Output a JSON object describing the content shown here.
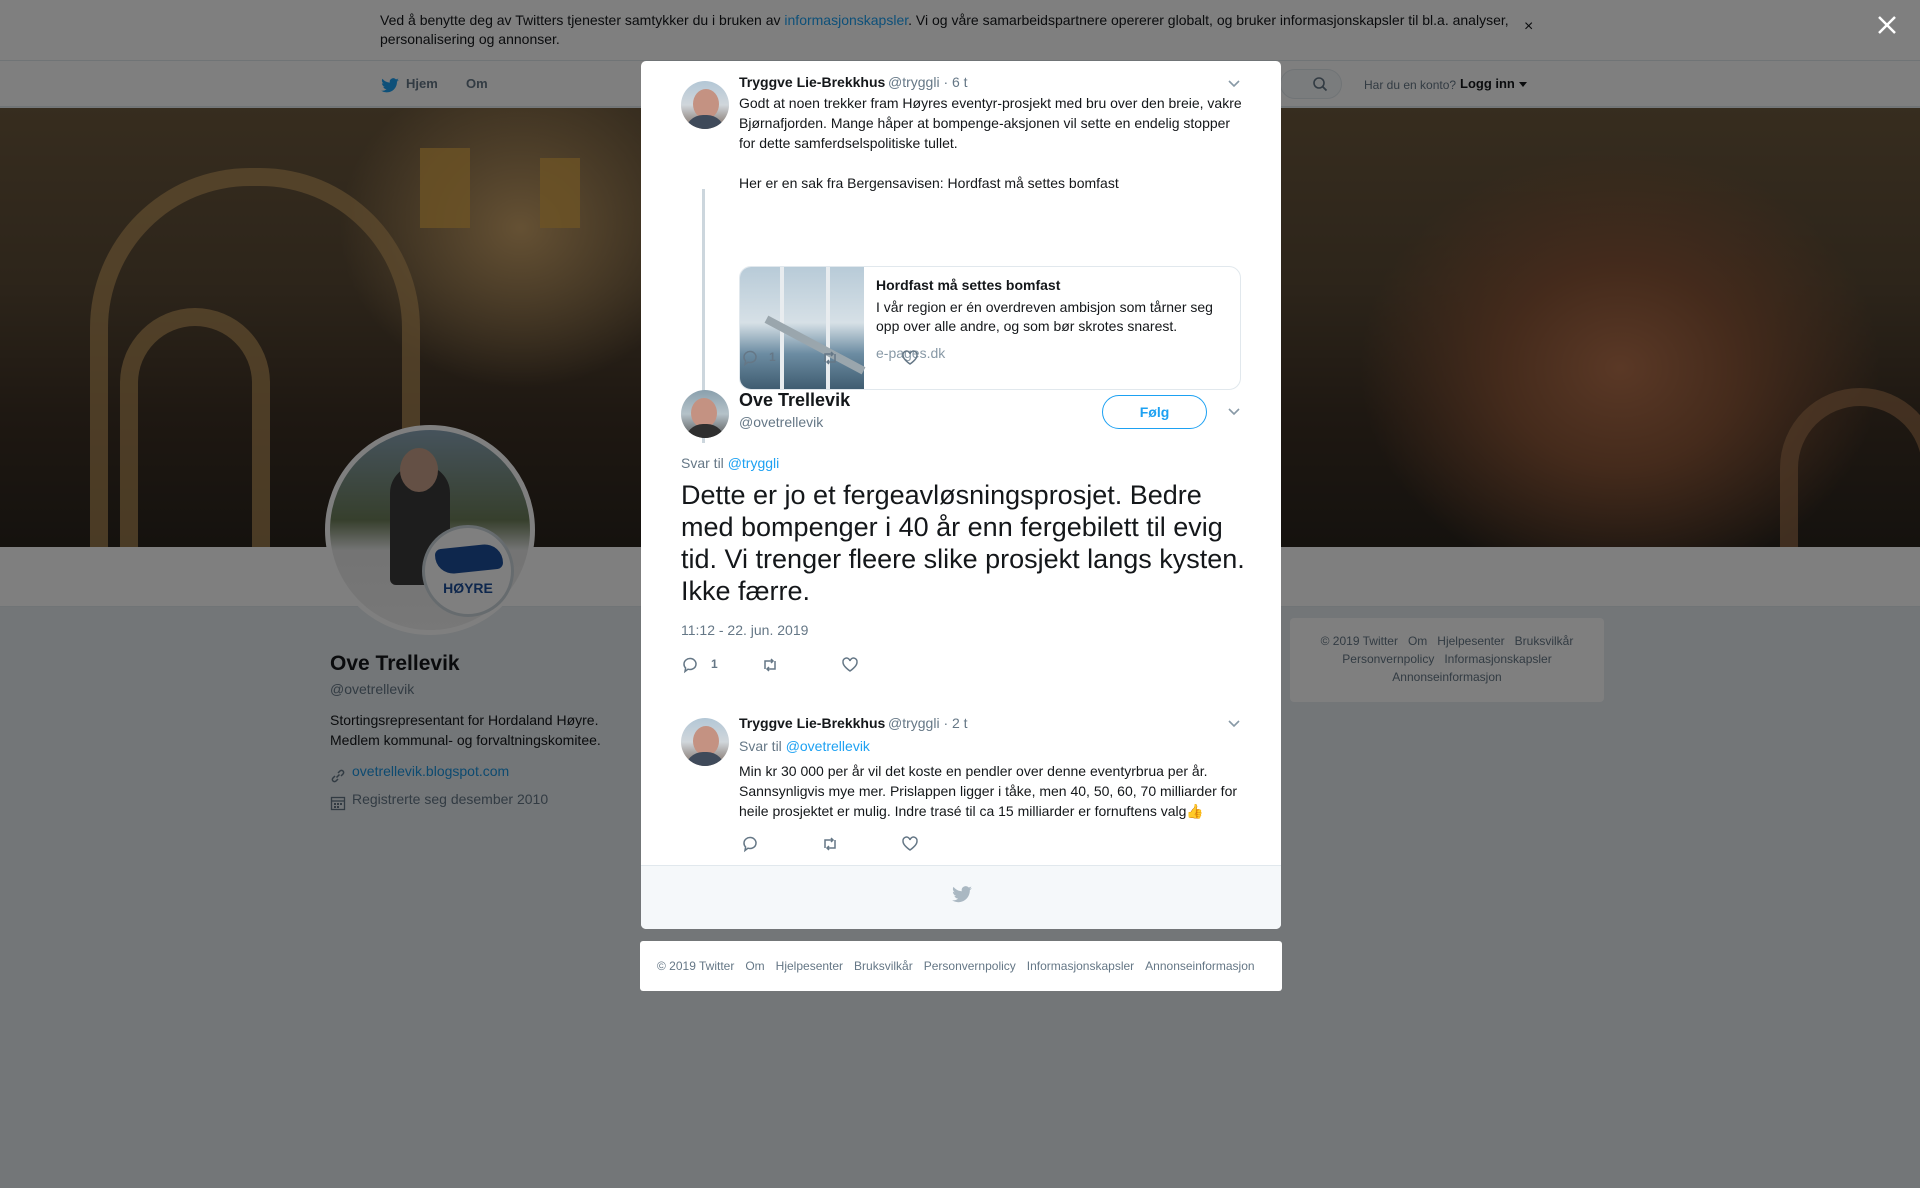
{
  "cookie": {
    "text_before": "Ved å benytte deg av Twitters tjenester samtykker du i bruken av ",
    "link": "informasjonskapsler",
    "text_after": ". Vi og våre samarbeidspartnere opererer globalt, og bruker informasjonskapsler til bl.a. analyser, personalisering og annonser.",
    "close": "×"
  },
  "nav": {
    "home": "Hjem",
    "about": "Om",
    "login_question": "Har du en konto?",
    "login": "Logg inn"
  },
  "avatar_badge": {
    "text": "HØYRE"
  },
  "profile": {
    "name": "Ove Trellevik",
    "handle": "@ovetrellevik",
    "bio": "Stortingsrepresentant for Hordaland Høyre. Medlem kommunal- og forvaltningskomitee.",
    "url": "ovetrellevik.blogspot.com",
    "joined": "Registrerte seg desember 2010"
  },
  "side_footer": [
    "© 2019 Twitter",
    "Om",
    "Hjelpesenter",
    "Bruksvilkår",
    "Personvernpolicy",
    "Informasjonskapsler",
    "Annonseinformasjon"
  ],
  "modal": {
    "parent_tweet": {
      "name": "Tryggve Lie-Brekkhus",
      "handle": "@tryggli",
      "time": "· 6 t",
      "text": "Godt at noen trekker fram Høyres eventyr-prosjekt med bru over den breie, vakre Bjørnafjorden. Mange håper at bompenge-aksjonen vil sette en endelig stopper for dette samferdselspolitiske tullet.",
      "text2": "Her er en sak fra Bergensavisen: Hordfast må settes bomfast",
      "card": {
        "title": "Hordfast må settes bomfast",
        "description": "I vår region er én overdreven ambisjon som tårner seg opp over alle andre, og som bør skrotes snarest.",
        "domain": "e-pages.dk"
      },
      "reply_count": "1"
    },
    "main_tweet": {
      "name": "Ove Trellevik",
      "handle": "@ovetrellevik",
      "follow": "Følg",
      "reply_label": "Svar til ",
      "reply_to": "@tryggli",
      "text": "Dette er jo et fergeavløsningsprosjet. Bedre med bompenger i 40 år enn fergebilett til evig tid. Vi trenger fleere slike prosjekt langs kysten. Ikke færre.",
      "timestamp": "11:12 - 22. jun. 2019",
      "reply_count": "1"
    },
    "reply_tweet": {
      "name": "Tryggve Lie-Brekkhus",
      "handle": "@tryggli",
      "time": "· 2 t",
      "reply_label": "Svar til ",
      "reply_to": "@ovetrellevik",
      "text": "Min kr 30 000 per år vil det koste en pendler over denne eventyrbrua per år. Sannsynligvis mye mer. Prislappen ligger i tåke, men 40, 50, 60, 70 milliarder for heile prosjektet er mulig. Indre trasé til ca 15 milliarder er fornuftens valg👍"
    }
  },
  "page_footer": [
    "© 2019 Twitter",
    "Om",
    "Hjelpesenter",
    "Bruksvilkår",
    "Personvernpolicy",
    "Informasjonskapsler",
    "Annonseinformasjon"
  ],
  "icons": {
    "bird": "twitter-bird-icon",
    "search": "search-icon",
    "close": "close-icon",
    "reply": "reply-icon",
    "retweet": "retweet-icon",
    "like": "heart-icon",
    "chevron": "chevron-down-icon",
    "link": "link-icon",
    "calendar": "calendar-icon"
  },
  "colors": {
    "accent": "#1da1f2",
    "text": "#14171a",
    "muted": "#657786",
    "overlay": "rgba(0,0,0,0.5)"
  }
}
